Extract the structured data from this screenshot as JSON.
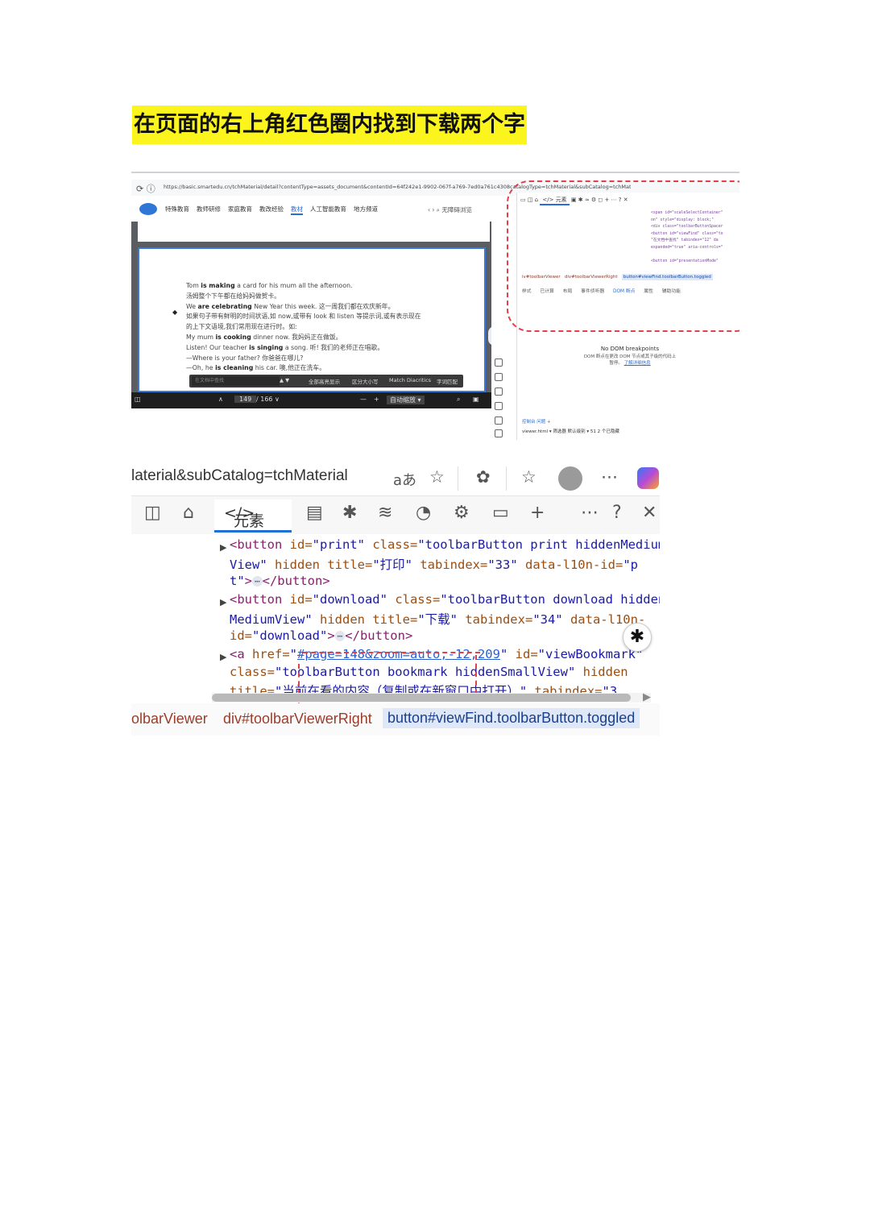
{
  "instruction": "在页面的右上角红色圈内找到下载两个字",
  "shot1": {
    "url": "https://basic.smartedu.cn/tchMaterial/detail?contentType=assets_document&contentId=64f242e1-9902-067f-a769-7ed0a761c4308catalogType=tchMaterial&subCatalog=tchMaterial",
    "site_menu": [
      "特殊教育",
      "教师研修",
      "家庭教育",
      "教改经验",
      "教材",
      "人工智能教育",
      "地方频道"
    ],
    "active_menu_index": 4,
    "search_placeholder": "无障碍浏览",
    "doc_lines": [
      {
        "pre": "Tom ",
        "bold": "is making",
        "post": " a card for his mum all the afternoon."
      },
      {
        "pre": "汤姆整个下午都在给妈妈做贺卡。",
        "bold": "",
        "post": ""
      },
      {
        "pre": "We ",
        "bold": "are celebrating",
        "post": " New Year this week. 这一周我们都在欢庆新年。"
      },
      {
        "pre": "如果句子带有鲜明的时间状语,如 now,或带有 look 和 listen 等提示词,或有表示现在",
        "bold": "",
        "post": ""
      },
      {
        "pre": "的上下文语境,我们常用现在进行时。如:",
        "bold": "",
        "post": ""
      },
      {
        "pre": "My mum ",
        "bold": "is cooking",
        "post": " dinner now. 我妈妈正在做饭。"
      },
      {
        "pre": "Listen! Our teacher ",
        "bold": "is singing",
        "post": " a song. 听! 我们的老师正在唱歌。"
      },
      {
        "pre": "—Where is your father? 你爸爸在哪儿?",
        "bold": "",
        "post": ""
      },
      {
        "pre": "—Oh, he ",
        "bold": "is cleaning",
        "post": " his car. 噢,他正在洗车。"
      }
    ],
    "bullet": "◆",
    "find_placeholder": "在文档中查找",
    "find_buttons": [
      "全部高亮显示",
      "区分大小写",
      "Match Diacritics",
      "字词匹配"
    ],
    "page_current": "149",
    "page_total": "/ 166",
    "zoom": "自动缩放",
    "devtools_tabs": "元素",
    "code_lines": [
      "<span id=\"scaleSelectContainer\"",
      "on\" style=\"display: block;\"",
      "<div class=\"toolbarButtonSpacer",
      "<button id=\"viewFind\" class=\"to",
      "\"在文档中查找\" tabindex=\"12\" da",
      "expanded=\"true\" aria-controls=\"",
      "",
      "<button id=\"presentationMode\""
    ],
    "crumbs": [
      "iv#toolbarViewer",
      "div#toolbarViewerRight",
      "button#viewFind.toolbarButton.toggled"
    ],
    "subtabs": [
      "样式",
      "已计算",
      "布局",
      "事件侦听器",
      "DOM 断点",
      "属性",
      "辅助功能"
    ],
    "active_subtab_index": 4,
    "no_dom_title": "No DOM breakpoints",
    "no_dom_sub": "DOM 断点在更改 DOM 节点或其子级的代码上",
    "no_dom_sub2": "暂停。",
    "no_dom_link": "了解详细信息",
    "console_tabs": "控制台    问题    +",
    "console_bar": "viewer.html ▾    筛选器         默认级别 ▾   51   2 个已隐藏"
  },
  "shot2": {
    "url_fragment": "laterial&subCatalog=tchMaterial",
    "read_aloud_icon": "aあ",
    "elements_tab_label": "元素",
    "code": {
      "l1": {
        "tag_open": "<button ",
        "id_attr": "id=",
        "id_val": "\"print\"",
        "cls_attr": " class=",
        "cls_val": "\"toolbarButton print hiddenMedium"
      },
      "l2": {
        "cls_val_cont": "View\"",
        "hidden": " hidden ",
        "title_attr": "title=",
        "title_val": "\"打印\"",
        "tab_attr": " tabindex=",
        "tab_val": "\"33\"",
        "data_attr": " data-l10n-id=",
        "data_val": "\"p"
      },
      "l3": {
        "data_val_cont": "t\"",
        "gt": ">",
        "ellipsis": "⋯",
        "close": "</button>"
      },
      "l4": {
        "tag_open": "<button ",
        "id_attr": "id=",
        "id_val": "\"download\"",
        "cls_attr": " class=",
        "cls_val": "\"toolbarButton download hidden"
      },
      "l5": {
        "cls_val_cont": "MediumView\"",
        "hidden": " hidden ",
        "title_attr": "title=",
        "title_val": "\"下载\"",
        "tab_attr": " tabindex=",
        "tab_val": "\"34\"",
        "data_attr": " data-l10n-"
      },
      "l6": {
        "data_attr_cont": "id=",
        "data_val": "\"download\"",
        "gt": ">",
        "ellipsis": "⋯",
        "close": "</button>"
      },
      "l7": {
        "tag_open": "<a ",
        "href_attr": "href=",
        "href_q": "\"",
        "href_val": "#page=148&zoom=auto,-12,209",
        "href_q2": "\"",
        "id_attr": " id=",
        "id_val": "\"viewBookmark\""
      },
      "l8": {
        "cls_attr": "class=",
        "cls_val": "\"toolbarButton bookmark hiddenSmallView\"",
        "hidden": " hidden"
      },
      "l9": {
        "title_attr": "title=",
        "title_val": "\"当前在看的内容（复制或在新窗口中打开）\"",
        "tab_attr": " tabindex=",
        "tab_val": "\"3"
      }
    },
    "crumbs": [
      "olbarViewer",
      "div#toolbarViewerRight",
      "button#viewFind.toolbarButton.toggled"
    ]
  },
  "colors": {
    "highlight": "#fbf51d",
    "ring": "#e0414a",
    "accent": "#1f6fd6"
  }
}
